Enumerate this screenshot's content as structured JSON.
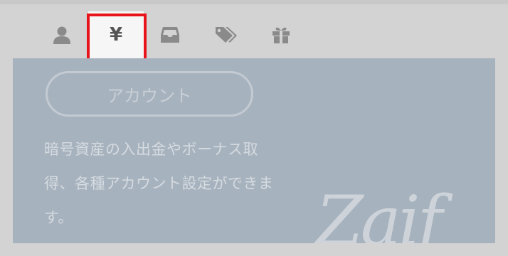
{
  "tabs": [
    {
      "id": "account",
      "icon": "user-icon",
      "active": false
    },
    {
      "id": "yen",
      "icon": "yen-icon",
      "active": true,
      "label": "¥"
    },
    {
      "id": "inbox",
      "icon": "inbox-icon",
      "active": false
    },
    {
      "id": "tags",
      "icon": "tag-icon",
      "active": false
    },
    {
      "id": "gift",
      "icon": "gift-icon",
      "active": false
    }
  ],
  "panel": {
    "button_label": "アカウント",
    "description": "暗号資産の入出金やボーナス取得、各種アカウント設定ができます。",
    "logo_text": "Zaif"
  },
  "colors": {
    "background": "#d3d3d3",
    "panel": "#a6b2be",
    "highlight": "#e8141c",
    "icon": "#8a8a8a"
  }
}
